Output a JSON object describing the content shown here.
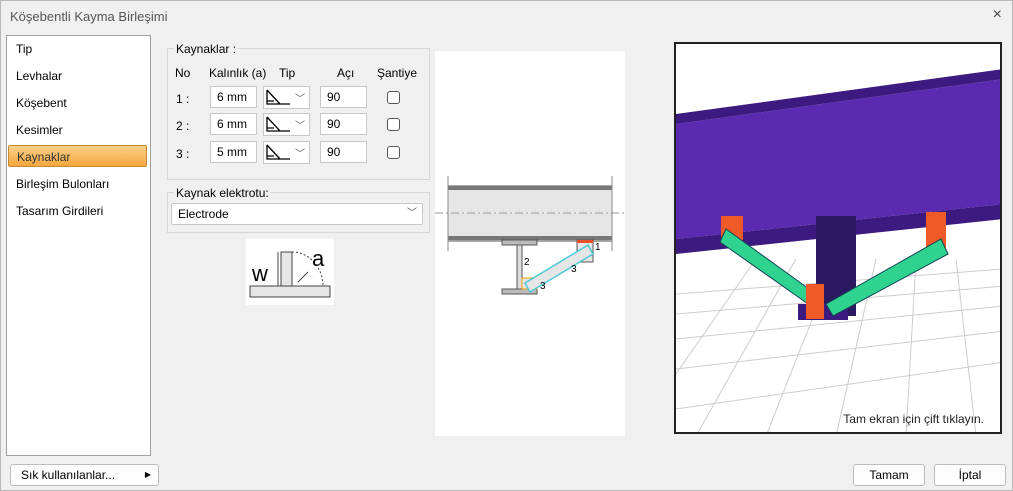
{
  "window": {
    "title": "Köşebentli Kayma Birleşimi",
    "close_icon": "×"
  },
  "sidebar": {
    "items": [
      {
        "label": "Tip"
      },
      {
        "label": "Levhalar"
      },
      {
        "label": "Köşebent"
      },
      {
        "label": "Kesimler"
      },
      {
        "label": "Kaynaklar",
        "selected": true
      },
      {
        "label": "Birleşim Bulonları"
      },
      {
        "label": "Tasarım Girdileri"
      }
    ]
  },
  "welds": {
    "group_title": "Kaynaklar :",
    "headers": {
      "no": "No",
      "thickness": "Kalınlık (a)",
      "type": "Tip",
      "angle": "Açı",
      "site": "Şantiye"
    },
    "rows": [
      {
        "no": "1 :",
        "thickness": "6 mm",
        "angle": "90",
        "site": false
      },
      {
        "no": "2 :",
        "thickness": "6 mm",
        "angle": "90",
        "site": false
      },
      {
        "no": "3 :",
        "thickness": "5 mm",
        "angle": "90",
        "site": false
      }
    ]
  },
  "electrode": {
    "group_title": "Kaynak elektrotu:",
    "value": "Electrode"
  },
  "weld_diagram": {
    "w": "w",
    "a": "a"
  },
  "section_diagram": {
    "labels": [
      "1",
      "2",
      "3",
      "3"
    ]
  },
  "viewer": {
    "hint": "Tam ekran için çift tıklayın."
  },
  "footer": {
    "favorites": "Sık kullanılanlar...",
    "ok": "Tamam",
    "cancel": "İptal"
  }
}
